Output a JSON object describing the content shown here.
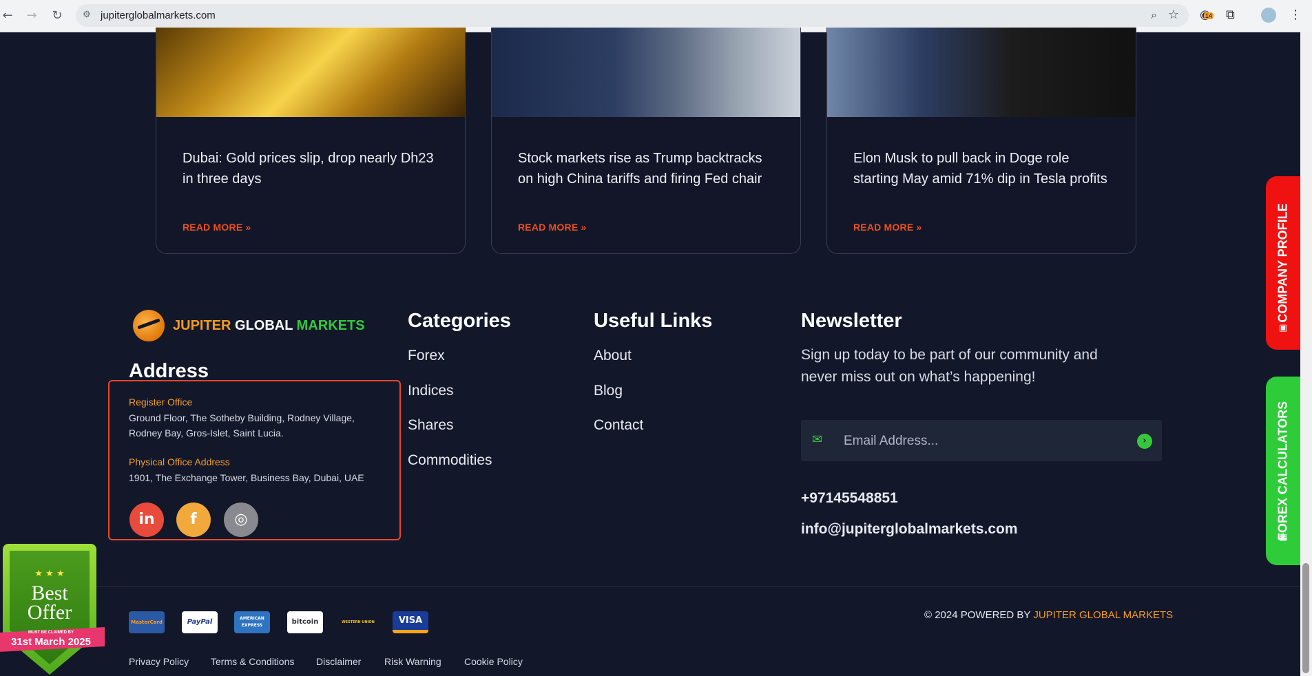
{
  "browser": {
    "url": "jupiterglobalmarkets.com",
    "extension_badge": "14"
  },
  "cards": [
    {
      "title": "Dubai: Gold prices slip, drop nearly Dh23 in three days",
      "read_more": "READ MORE »"
    },
    {
      "title": "Stock markets rise as Trump backtracks on high China tariffs and firing Fed chair",
      "read_more": "READ MORE »"
    },
    {
      "title": "Elon Musk to pull back in Doge role starting May amid 71% dip in Tesla profits",
      "read_more": "READ MORE »"
    }
  ],
  "logo": {
    "part1": "JUPITER",
    "part2": "GLOBAL",
    "part3": "MARKETS"
  },
  "address": {
    "heading": "Address",
    "register_label": "Register Office",
    "register_line1": "Ground Floor, The Sotheby Building, Rodney Village,",
    "register_line2": "Rodney Bay, Gros-Islet, Saint Lucia.",
    "physical_label": "Physical Office Address",
    "physical_text": "1901, The Exchange Tower, Business Bay, Dubai, UAE"
  },
  "categories": {
    "heading": "Categories",
    "items": [
      "Forex",
      "Indices",
      "Shares",
      "Commodities"
    ]
  },
  "useful_links": {
    "heading": "Useful Links",
    "items": [
      "About",
      "Blog",
      "Contact"
    ]
  },
  "newsletter": {
    "heading": "Newsletter",
    "text": "Sign up today to be part of our community and never miss out on what’s happening!",
    "placeholder": "Email Address...",
    "phone": "+97145548851",
    "email": "info@jupiterglobalmarkets.com"
  },
  "payments": [
    "MasterCard",
    "PayPal",
    "AMERICAN EXPRESS",
    "bitcoin",
    "WESTERN UNION",
    "VISA"
  ],
  "copyright": {
    "prefix": "© 2024 POWERED BY ",
    "brand": "JUPITER GLOBAL MARKETS"
  },
  "legal": [
    "Privacy Policy",
    "Terms & Conditions",
    "Disclaimer",
    "Risk Warning",
    "Cookie Policy"
  ],
  "side_tabs": {
    "profile": "COMPANY PROFILE",
    "calculators": "FOREX CALCULATORS"
  },
  "offer_badge": {
    "title_line1": "Best",
    "title_line2": "Offer",
    "subtext": "MUST BE CLAIMED BY",
    "date": "31st March 2025"
  },
  "colors": {
    "accent_orange": "#e9501f",
    "label_orange": "#f29d2a",
    "green": "#35c83c",
    "background": "#13172a",
    "profile_red": "#f01111"
  }
}
